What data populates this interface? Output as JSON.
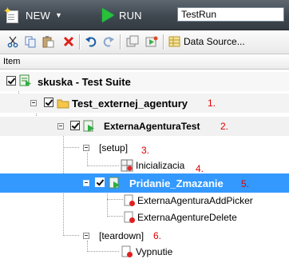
{
  "toolbar": {
    "new_label": "NEW",
    "run_label": "RUN",
    "testrun_value": "TestRun",
    "datasource_label": "Data Source..."
  },
  "column_header": "Item",
  "tree": {
    "suite": {
      "label": "skuska - Test Suite"
    },
    "folder": {
      "label": "Test_externej_agentury",
      "annotation": "1."
    },
    "test": {
      "label": "ExternaAgenturaTest",
      "annotation": "2."
    },
    "setup": {
      "label": "[setup]",
      "annotation": "3."
    },
    "inicializacia": {
      "label": "Inicializacia",
      "annotation": "4."
    },
    "pridanie": {
      "label": "Pridanie_Zmazanie",
      "annotation": "5."
    },
    "picker": {
      "label": "ExternaAgenturaAddPicker"
    },
    "delete": {
      "label": "ExternaAgentureDelete"
    },
    "teardown": {
      "label": "[teardown]",
      "annotation": "6."
    },
    "vypnutie": {
      "label": "Vypnutie"
    }
  },
  "colors": {
    "selection": "#3399ff",
    "annotation": "#e00000",
    "run_green": "#27c23a"
  }
}
